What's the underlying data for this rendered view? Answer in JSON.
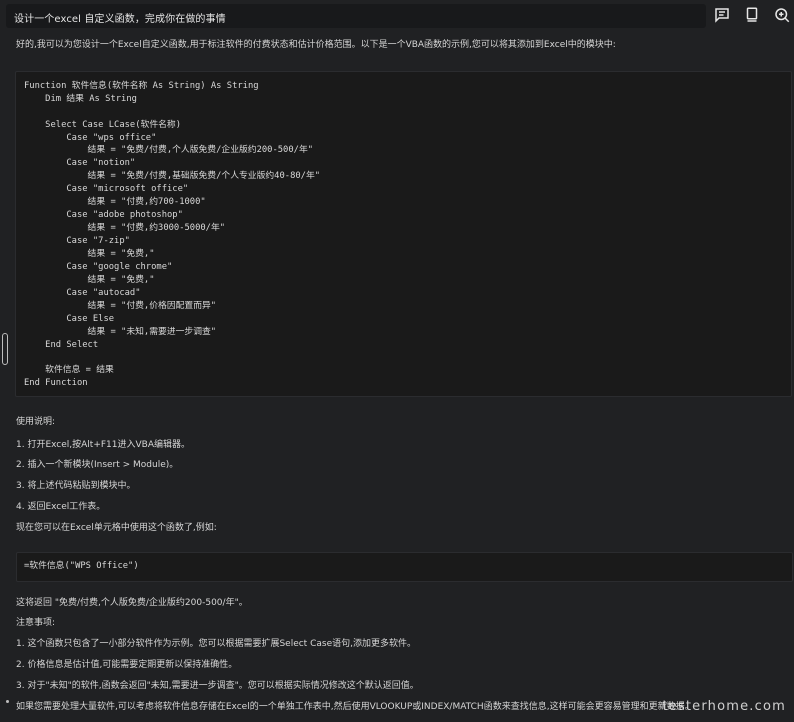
{
  "top_bar": {
    "prompt": "设计一个excel 自定义函数，完成你在做的事情"
  },
  "icons": {
    "chat": "chat-bubble-icon",
    "doc": "document-icon",
    "zoom": "zoom-in-icon"
  },
  "content": {
    "intro": "好的,我可以为您设计一个Excel自定义函数,用于标注软件的付费状态和估计价格范围。以下是一个VBA函数的示例,您可以将其添加到Excel中的模块中:",
    "code": "Function 软件信息(软件名称 As String) As String\n    Dim 结果 As String\n\n    Select Case LCase(软件名称)\n        Case \"wps office\"\n            结果 = \"免费/付费,个人版免费/企业版约200-500/年\"\n        Case \"notion\"\n            结果 = \"免费/付费,基础版免费/个人专业版约40-80/年\"\n        Case \"microsoft office\"\n            结果 = \"付费,约700-1000\"\n        Case \"adobe photoshop\"\n            结果 = \"付费,约3000-5000/年\"\n        Case \"7-zip\"\n            结果 = \"免费,\"\n        Case \"google chrome\"\n            结果 = \"免费,\"\n        Case \"autocad\"\n            结果 = \"付费,价格因配置而异\"\n        Case Else\n            结果 = \"未知,需要进一步调查\"\n    End Select\n\n    软件信息 = 结果\nEnd Function",
    "usage_title": "使用说明:",
    "steps": [
      "1. 打开Excel,按Alt+F11进入VBA编辑器。",
      "2. 插入一个新模块(Insert > Module)。",
      "3. 将上述代码粘贴到模块中。",
      "4. 返回Excel工作表。"
    ],
    "usage_now": "现在您可以在Excel单元格中使用这个函数了,例如:",
    "example": "=软件信息(\"WPS Office\")",
    "return_line": "这将返回 \"免费/付费,个人版免费/企业版约200-500/年\"。",
    "notes_title": "注意事项:",
    "notes": [
      "1. 这个函数只包含了一小部分软件作为示例。您可以根据需要扩展Select Case语句,添加更多软件。",
      "2. 价格信息是估计值,可能需要定期更新以保持准确性。",
      "3. 对于\"未知\"的软件,函数会返回\"未知,需要进一步调查\"。您可以根据实际情况修改这个默认返回值。"
    ],
    "final_note": "如果您需要处理大量软件,可以考虑将软件信息存储在Excel的一个单独工作表中,然后使用VLOOKUP或INDEX/MATCH函数来查找信息,这样可能会更容易管理和更新数据。"
  },
  "watermark": "testerhome.com"
}
